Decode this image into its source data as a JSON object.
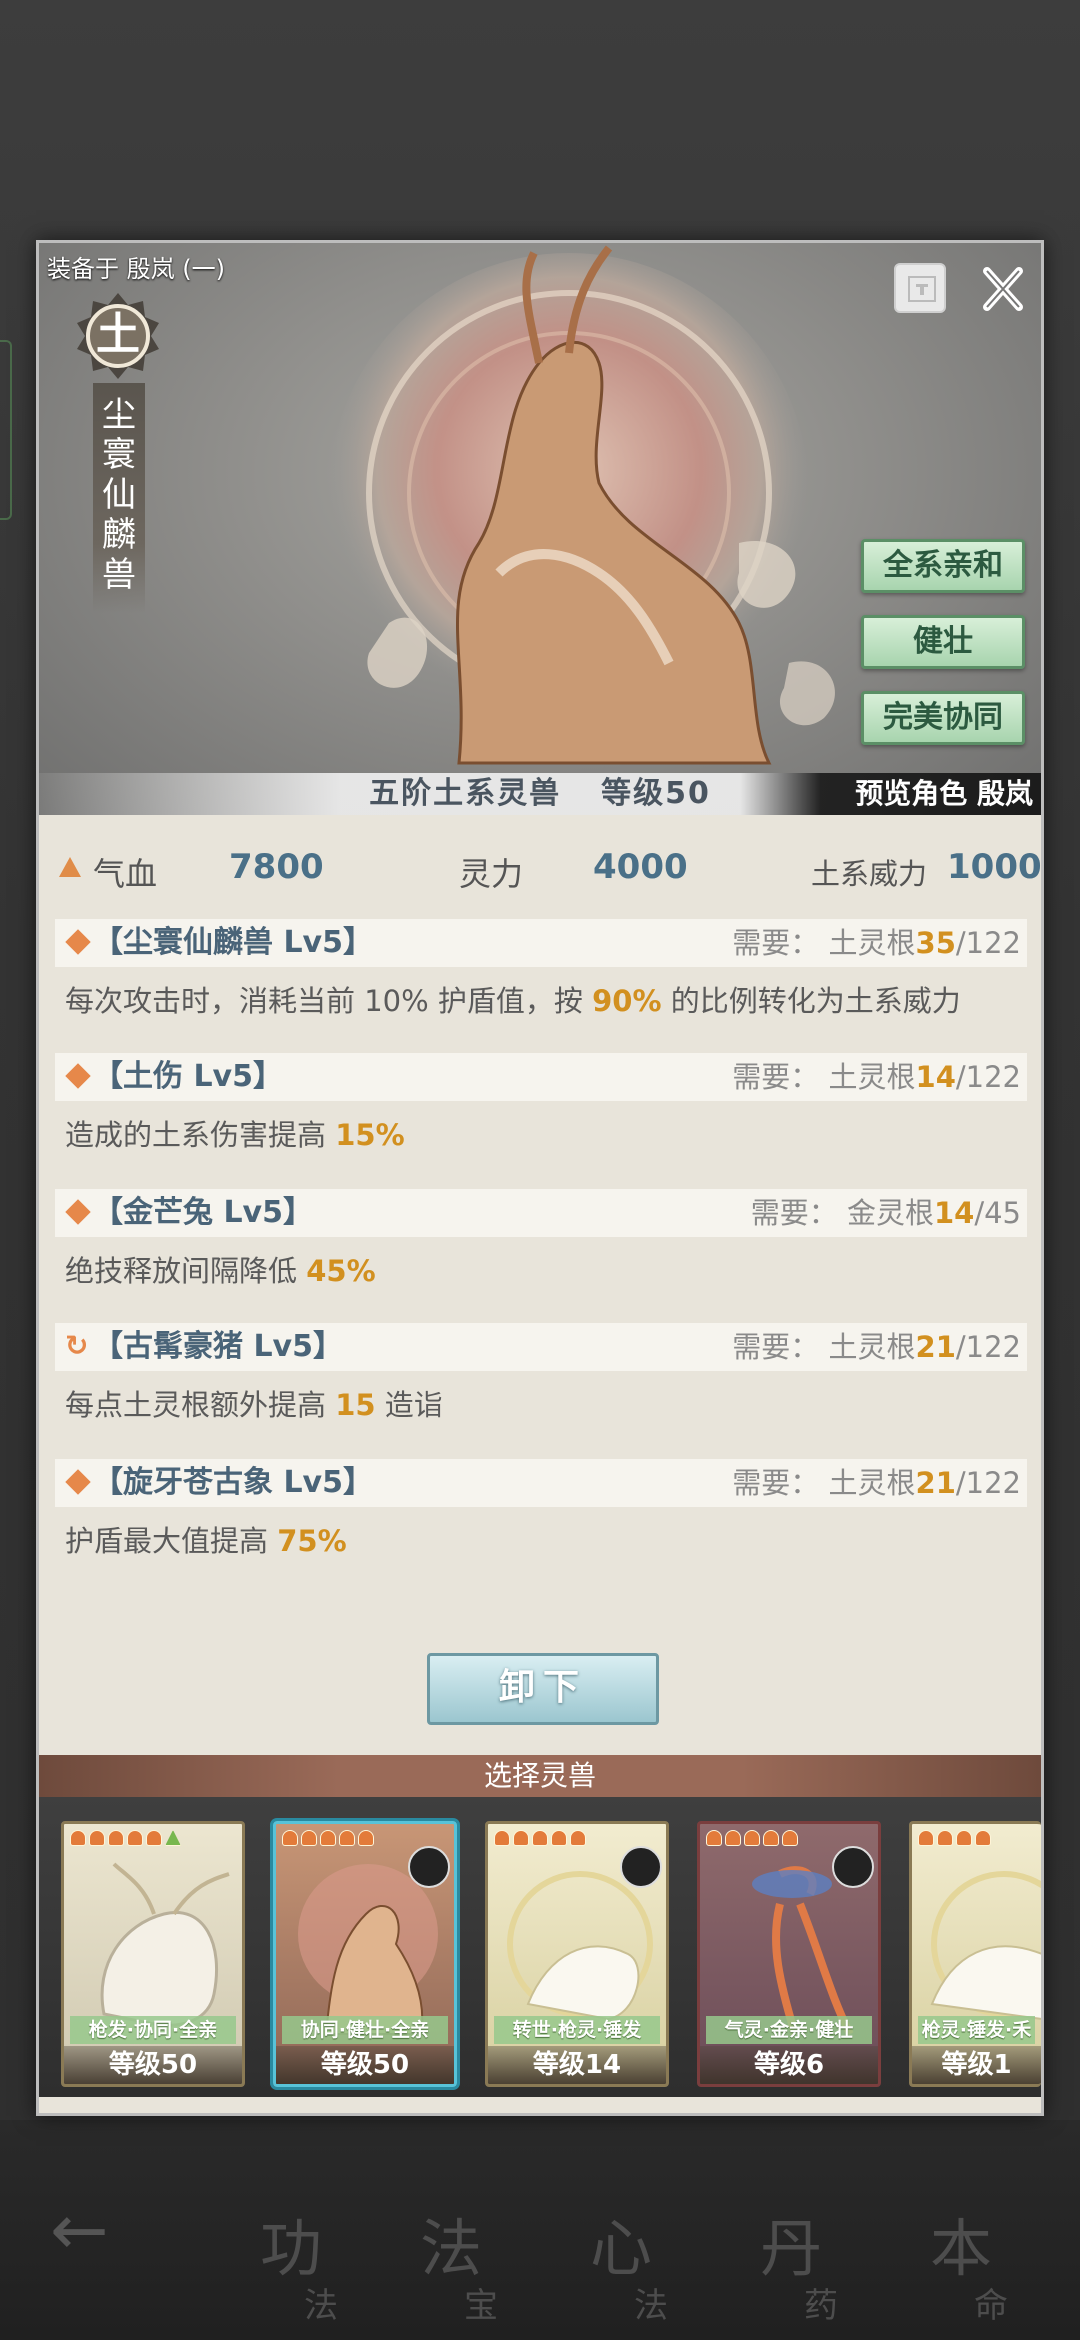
{
  "equipped_label": "装备于 殷岚 (一)",
  "element": "土",
  "beast_name_chars": [
    "尘",
    "寰",
    "仙",
    "麟",
    "兽"
  ],
  "traits": [
    "全系亲和",
    "健壮",
    "完美协同"
  ],
  "tier": "五阶土系灵兽",
  "level": "等级50",
  "preview_role": "预览角色 殷岚",
  "stats": {
    "hp_label": "气血",
    "hp_value": "7800",
    "sp_label": "灵力",
    "sp_value": "4000",
    "power_label": "土系威力",
    "power_value": "1000"
  },
  "skills": [
    {
      "name": "【尘寰仙麟兽 Lv5】",
      "req_prefix": "需要：  土灵根",
      "req_cur": "35",
      "req_max": "/122",
      "desc_pre": "每次攻击时，消耗当前 10% 护盾值，按 ",
      "desc_hl": "90%",
      "desc_post": " 的比例转化为土系威力"
    },
    {
      "name": "【土伤 Lv5】",
      "req_prefix": "需要：  土灵根",
      "req_cur": "14",
      "req_max": "/122",
      "desc_pre": "造成的土系伤害提高 ",
      "desc_hl": "15%",
      "desc_post": ""
    },
    {
      "name": "【金芒兔 Lv5】",
      "req_prefix": "需要：  金灵根",
      "req_cur": "14",
      "req_max": "/45",
      "desc_pre": "绝技释放间隔降低 ",
      "desc_hl": "45%",
      "desc_post": ""
    },
    {
      "name": "【古髯豪猪 Lv5】",
      "req_prefix": "需要：  土灵根",
      "req_cur": "21",
      "req_max": "/122",
      "desc_pre": "每点土灵根额外提高 ",
      "desc_hl": "15",
      "desc_post": " 造诣"
    },
    {
      "name": "【旋牙苍古象 Lv5】",
      "req_prefix": "需要：  土灵根",
      "req_cur": "21",
      "req_max": "/122",
      "desc_pre": "护盾最大值提高 ",
      "desc_hl": "75%",
      "desc_post": ""
    }
  ],
  "unequip_label": "卸下",
  "select_title": "选择灵兽",
  "cards": [
    {
      "tags": "枪发·协同·全亲",
      "level": "等级50"
    },
    {
      "tags": "协同·健壮·全亲",
      "level": "等级50"
    },
    {
      "tags": "转世·枪灵·锤发",
      "level": "等级14"
    },
    {
      "tags": "气灵·金亲·健壮",
      "level": "等级6"
    },
    {
      "tags": "枪灵·锤发·禾",
      "level": "等级1"
    }
  ],
  "bottom_nav": [
    {
      "big": "功",
      "small": "法"
    },
    {
      "big": "法",
      "small": "宝"
    },
    {
      "big": "心",
      "small": "法"
    },
    {
      "big": "丹",
      "small": "药"
    },
    {
      "big": "本",
      "small": "命"
    }
  ],
  "colors": {
    "accent": "#d2901f",
    "skill_name": "#4a6478",
    "trait_green": "#a8d4ae",
    "select_bar": "#9a6a58"
  }
}
